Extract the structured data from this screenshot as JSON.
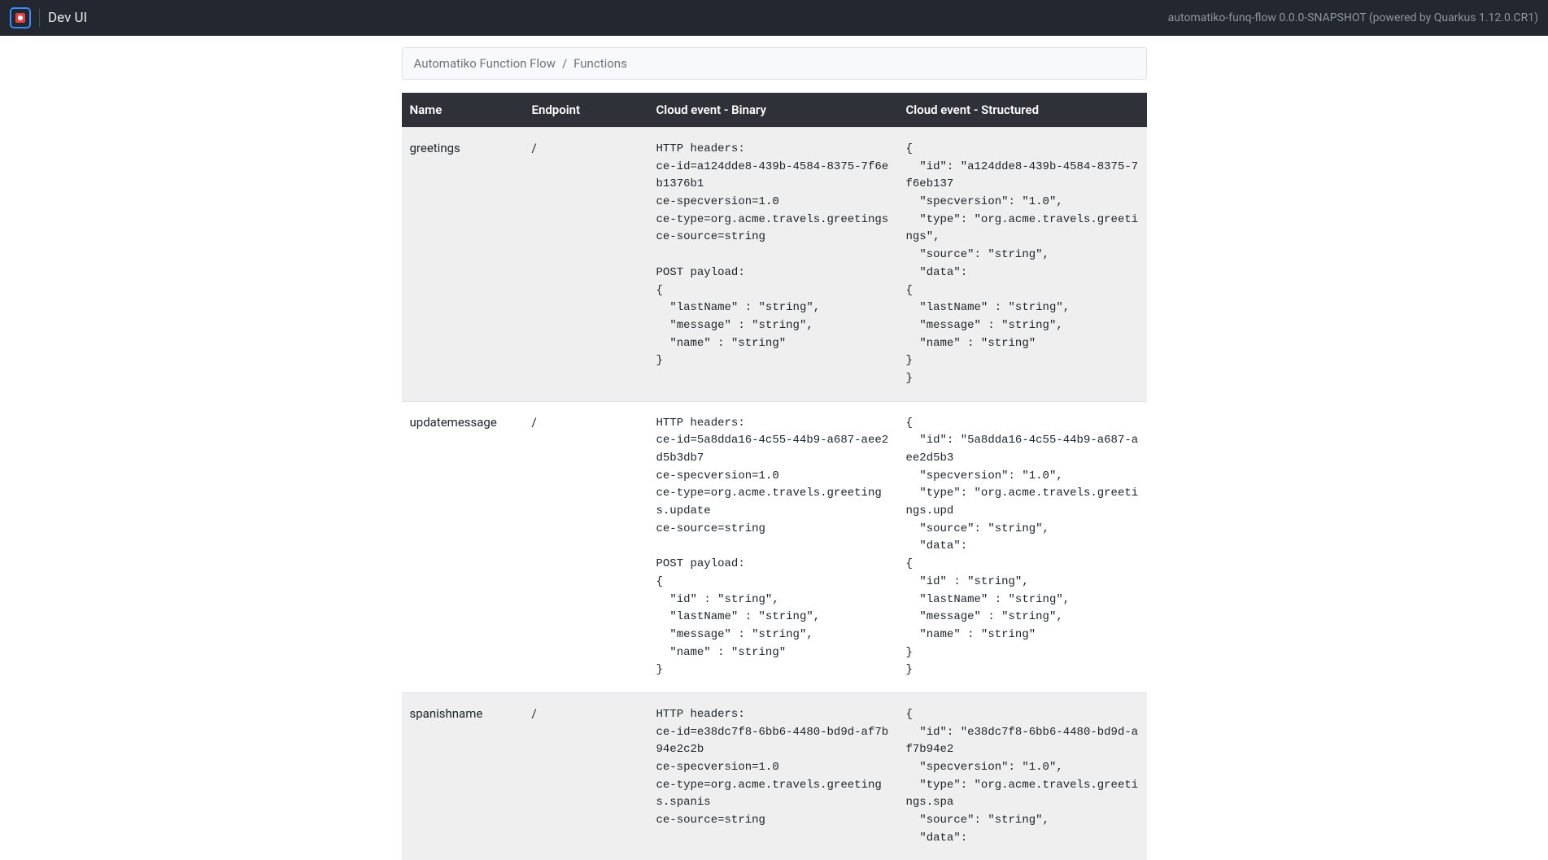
{
  "header": {
    "title": "Dev UI",
    "subtitle": "automatiko-funq-flow 0.0.0-SNAPSHOT (powered by Quarkus 1.12.0.CR1)"
  },
  "breadcrumb": {
    "parent": "Automatiko Function Flow",
    "separator": "/",
    "current": "Functions"
  },
  "table": {
    "headers": {
      "name": "Name",
      "endpoint": "Endpoint",
      "binary": "Cloud event - Binary",
      "structured": "Cloud event - Structured"
    },
    "rows": [
      {
        "name": "greetings",
        "endpoint": "/",
        "binary": "HTTP headers:\nce-id=a124dde8-439b-4584-8375-7f6eb1376b1\nce-specversion=1.0\nce-type=org.acme.travels.greetings\nce-source=string\n\nPOST payload:\n{\n  \"lastName\" : \"string\",\n  \"message\" : \"string\",\n  \"name\" : \"string\"\n}",
        "structured": "{\n  \"id\": \"a124dde8-439b-4584-8375-7f6eb137\n  \"specversion\": \"1.0\",\n  \"type\": \"org.acme.travels.greetings\",\n  \"source\": \"string\",\n  \"data\":\n{\n  \"lastName\" : \"string\",\n  \"message\" : \"string\",\n  \"name\" : \"string\"\n}\n}"
      },
      {
        "name": "updatemessage",
        "endpoint": "/",
        "binary": "HTTP headers:\nce-id=5a8dda16-4c55-44b9-a687-aee2d5b3db7\nce-specversion=1.0\nce-type=org.acme.travels.greetings.update\nce-source=string\n\nPOST payload:\n{\n  \"id\" : \"string\",\n  \"lastName\" : \"string\",\n  \"message\" : \"string\",\n  \"name\" : \"string\"\n}",
        "structured": "{\n  \"id\": \"5a8dda16-4c55-44b9-a687-aee2d5b3\n  \"specversion\": \"1.0\",\n  \"type\": \"org.acme.travels.greetings.upd\n  \"source\": \"string\",\n  \"data\":\n{\n  \"id\" : \"string\",\n  \"lastName\" : \"string\",\n  \"message\" : \"string\",\n  \"name\" : \"string\"\n}\n}"
      },
      {
        "name": "spanishname",
        "endpoint": "/",
        "binary": "HTTP headers:\nce-id=e38dc7f8-6bb6-4480-bd9d-af7b94e2c2b\nce-specversion=1.0\nce-type=org.acme.travels.greetings.spanis\nce-source=string\n",
        "structured": "{\n  \"id\": \"e38dc7f8-6bb6-4480-bd9d-af7b94e2\n  \"specversion\": \"1.0\",\n  \"type\": \"org.acme.travels.greetings.spa\n  \"source\": \"string\",\n  \"data\":"
      }
    ]
  }
}
